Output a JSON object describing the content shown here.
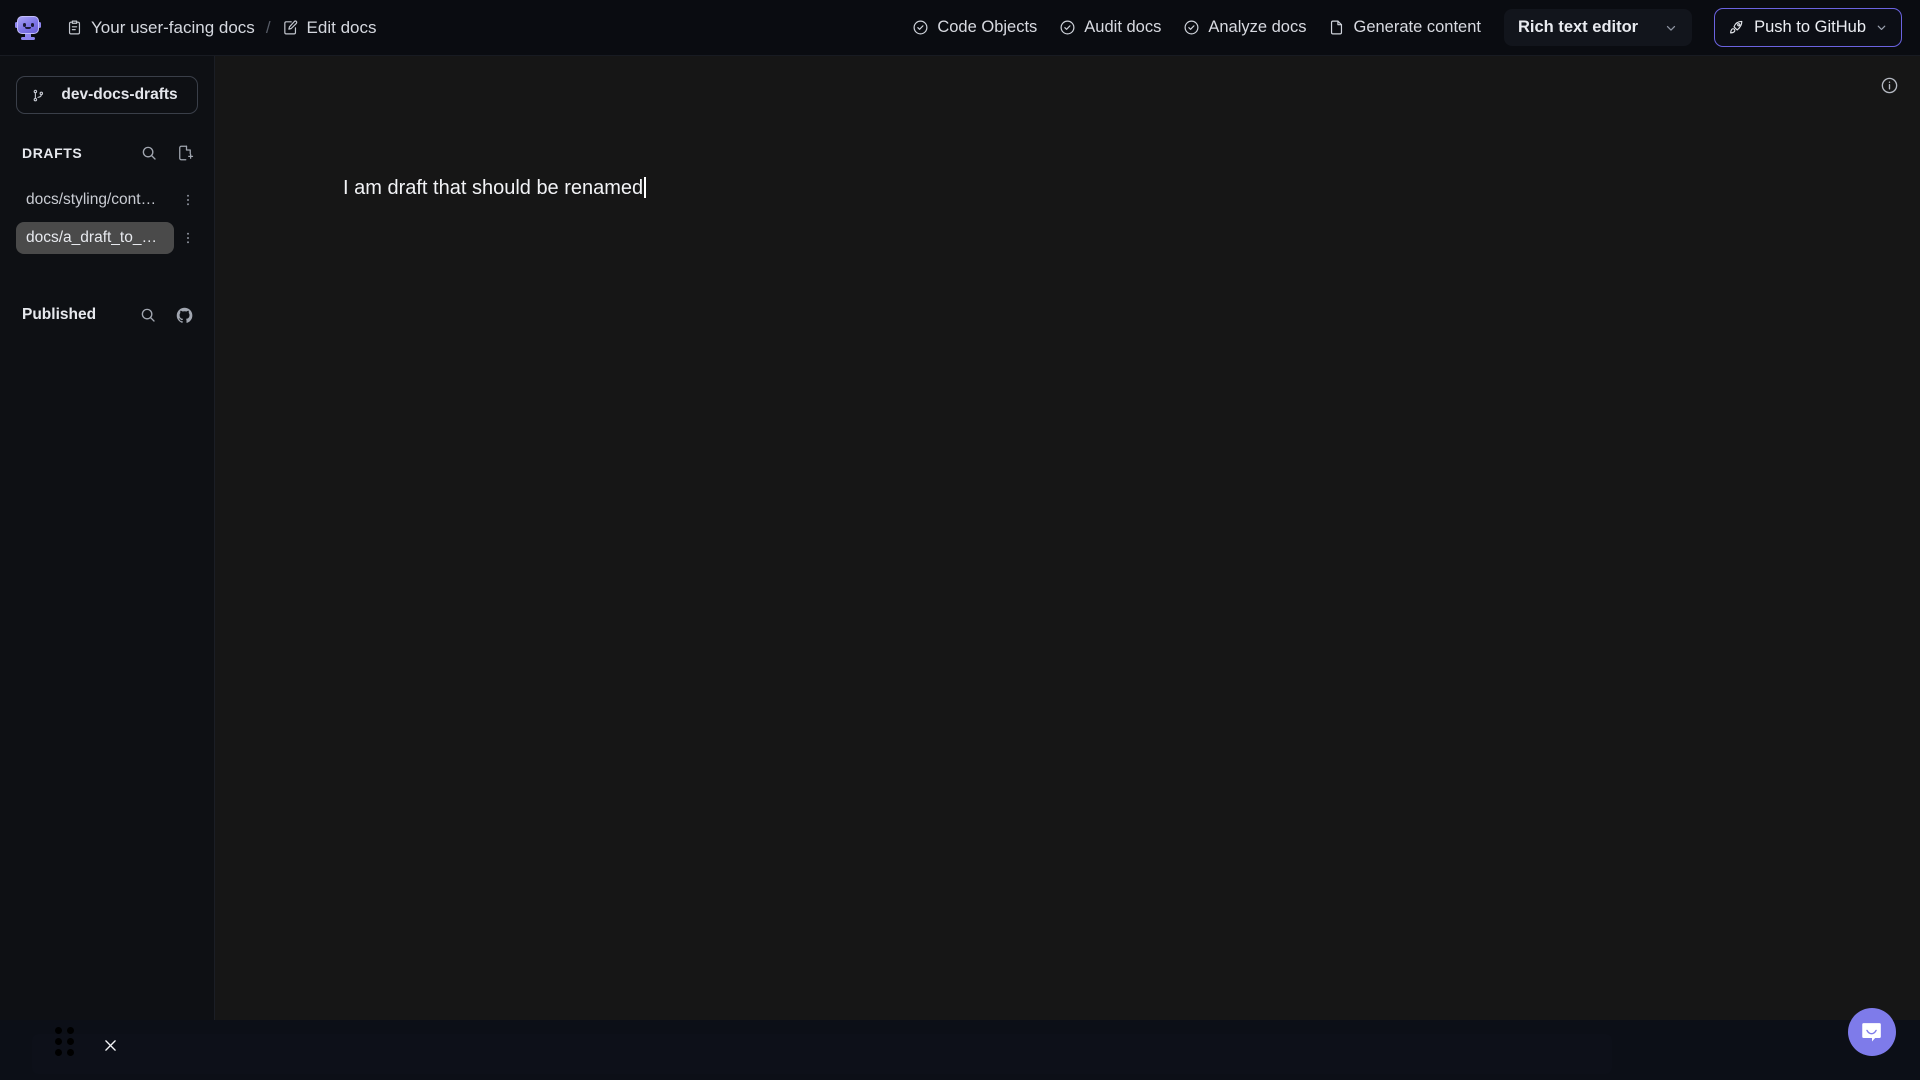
{
  "app": {
    "logo_icon": "robot-monitor-logo",
    "background": "#0b0d12",
    "accent": "#6b63e0"
  },
  "header": {
    "breadcrumb": [
      {
        "icon": "clipboard-icon",
        "label": "Your user-facing docs"
      },
      {
        "icon": "edit-document-icon",
        "label": "Edit docs"
      }
    ],
    "separator": "/",
    "actions": [
      {
        "icon": "check-circle-icon",
        "label": "Code Objects"
      },
      {
        "icon": "check-circle-icon",
        "label": "Audit docs"
      },
      {
        "icon": "check-circle-icon",
        "label": "Analyze docs"
      },
      {
        "icon": "document-icon",
        "label": "Generate content"
      }
    ],
    "editor_selector": {
      "label": "Rich text editor",
      "chevron": "chevron-down-icon"
    },
    "push_button": {
      "icon": "rocket-icon",
      "label": "Push to GitHub",
      "chevron": "chevron-down-icon",
      "border_color": "#6b63e0"
    }
  },
  "sidebar": {
    "branch": {
      "icon": "git-branch-icon",
      "name": "dev-docs-drafts"
    },
    "drafts": {
      "title": "DRAFTS",
      "search_icon": "search-icon",
      "new_file_icon": "new-document-icon",
      "files": [
        {
          "name": "docs/styling/context...",
          "menu_icon": "kebab-menu-icon",
          "active": false
        },
        {
          "name": "docs/a_draft_to_be...",
          "menu_icon": "kebab-menu-icon",
          "active": true
        }
      ]
    },
    "published": {
      "title": "Published",
      "search_icon": "search-icon",
      "github_icon": "github-icon",
      "files": []
    }
  },
  "main": {
    "info_icon": "info-circle-icon",
    "document_text": "I am draft that should be renamed"
  },
  "bottom": {
    "drag_handle_icon": "drag-dots-icon",
    "close_icon": "close-x-icon"
  },
  "chat": {
    "icon": "chat-bubble-icon",
    "color": "#7e7bea"
  }
}
